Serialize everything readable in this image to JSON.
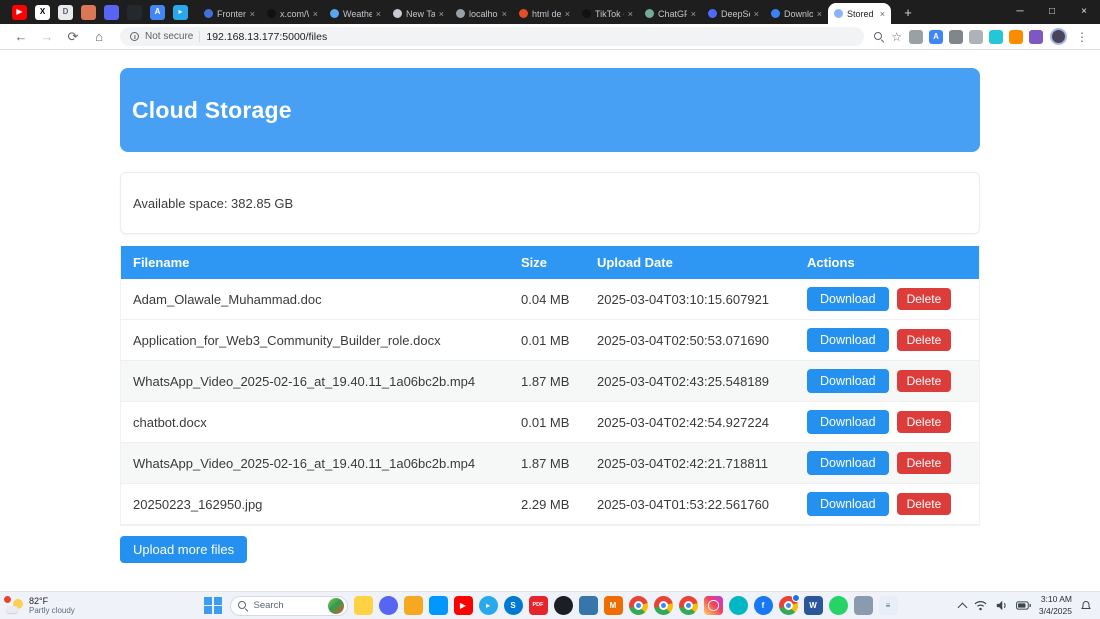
{
  "browser": {
    "new_tab_glyph": "+",
    "tab_close_glyph": "×",
    "window_controls": [
      "─",
      "□",
      "×"
    ],
    "nav_glyphs": {
      "back": "←",
      "forward": "→",
      "refresh": "⟳",
      "home": "⌂"
    },
    "bookmark_star_glyph": "☆",
    "menu_glyph": "⋮",
    "nav": {
      "security_label": "Not secure",
      "url": "192.168.13.177:5000/files"
    },
    "pinned_tabs": [
      {
        "name": "youtube-icon",
        "bg": "#ff0000",
        "fg": "#ffffff",
        "glyph": "▶"
      },
      {
        "name": "x-icon",
        "bg": "#ffffff",
        "fg": "#000000",
        "glyph": "X"
      },
      {
        "name": "docs-icon",
        "bg": "#e8eaed",
        "fg": "#5f6368",
        "glyph": "D"
      },
      {
        "name": "claude-icon",
        "bg": "#da7756",
        "fg": "#ffffff",
        "glyph": ""
      },
      {
        "name": "discord-icon",
        "bg": "#5865f2",
        "fg": "#ffffff",
        "glyph": ""
      },
      {
        "name": "github-icon",
        "bg": "#24292e",
        "fg": "#ffffff",
        "glyph": ""
      },
      {
        "name": "translate-icon",
        "bg": "#4285f4",
        "fg": "#ffffff",
        "glyph": "A"
      },
      {
        "name": "telegram-icon",
        "bg": "#29a9eb",
        "fg": "#ffffff",
        "glyph": "▸"
      }
    ],
    "tabs": [
      {
        "title": "Fronten",
        "favicon": "#4272d7"
      },
      {
        "title": "x.com/W",
        "favicon": "#111111"
      },
      {
        "title": "Weathe",
        "favicon": "#58a6f0"
      },
      {
        "title": "New Tab",
        "favicon": "#c7cbd1"
      },
      {
        "title": "localhost",
        "favicon": "#9aa0a6"
      },
      {
        "title": "html de",
        "favicon": "#e44d26"
      },
      {
        "title": "TikTok -",
        "favicon": "#111111"
      },
      {
        "title": "ChatGPT",
        "favicon": "#74aa9c"
      },
      {
        "title": "DeepSe",
        "favicon": "#4d6bfe"
      },
      {
        "title": "Downlo",
        "favicon": "#3b82f6"
      },
      {
        "title": "Stored F",
        "favicon": "#8ab4f8"
      }
    ],
    "extensions": [
      {
        "name": "keyboard-extension-icon",
        "bg": "#9aa0a6",
        "glyph": ""
      },
      {
        "name": "translate-extension-icon",
        "bg": "#4285f4",
        "fg": "#ffffff",
        "glyph": "A"
      },
      {
        "name": "cast-extension-icon",
        "bg": "#80868b",
        "glyph": ""
      },
      {
        "name": "image-extension-icon",
        "bg": "#aeb3b8",
        "glyph": ""
      },
      {
        "name": "teal-extension-icon",
        "bg": "#26c6da",
        "glyph": ""
      },
      {
        "name": "orange-extension-icon",
        "bg": "#fb8c00",
        "glyph": ""
      },
      {
        "name": "purple-extension-icon",
        "bg": "#7e57c2",
        "glyph": ""
      }
    ]
  },
  "page": {
    "header_title": "Cloud Storage",
    "available_space": "Available space: 382.85 GB",
    "upload_button": "Upload more files",
    "table": {
      "headers": [
        "Filename",
        "Size",
        "Upload Date",
        "Actions"
      ],
      "download_label": "Download",
      "delete_label": "Delete",
      "rows": [
        {
          "filename": "Adam_Olawale_Muhammad.doc",
          "size": "0.04 MB",
          "upload_date": "2025-03-04T03:10:15.607921"
        },
        {
          "filename": "Application_for_Web3_Community_Builder_role.docx",
          "size": "0.01 MB",
          "upload_date": "2025-03-04T02:50:53.071690"
        },
        {
          "filename": "WhatsApp_Video_2025-02-16_at_19.40.11_1a06bc2b.mp4",
          "size": "1.87 MB",
          "upload_date": "2025-03-04T02:43:25.548189"
        },
        {
          "filename": "chatbot.docx",
          "size": "0.01 MB",
          "upload_date": "2025-03-04T02:42:54.927224"
        },
        {
          "filename": "WhatsApp_Video_2025-02-16_at_19.40.11_1a06bc2b.mp4",
          "size": "1.87 MB",
          "upload_date": "2025-03-04T02:42:21.718811"
        },
        {
          "filename": "20250223_162950.jpg",
          "size": "2.29 MB",
          "upload_date": "2025-03-04T01:53:22.561760"
        }
      ]
    }
  },
  "taskbar": {
    "weather": {
      "temp": "82°F",
      "condition": "Partly cloudy"
    },
    "search_label": "Search",
    "tray": {
      "time": "3:10 AM",
      "date": "3/4/2025"
    },
    "icons": [
      {
        "name": "file-explorer-icon",
        "cls": "ic-sq",
        "bg": "#ffd243",
        "glyph": ""
      },
      {
        "name": "discord-icon",
        "cls": "ic-rd",
        "bg": "#5865f2",
        "glyph": ""
      },
      {
        "name": "folder-icon",
        "cls": "ic-sq",
        "bg": "#f6a821",
        "glyph": ""
      },
      {
        "name": "vscode-icon",
        "cls": "ic-sq",
        "bg": "#0098ff",
        "glyph": ""
      },
      {
        "name": "youtube-icon",
        "cls": "ic-sq",
        "bg": "#ff0000",
        "glyph": "▶"
      },
      {
        "name": "telegram-icon",
        "cls": "ic-rd",
        "bg": "#29a9eb",
        "glyph": "▸"
      },
      {
        "name": "skype-icon",
        "cls": "ic-rd",
        "bg": "#0078d4",
        "glyph": "S"
      },
      {
        "name": "pdf-icon",
        "cls": "ic-sq ic-pdf",
        "bg": "#e5252a",
        "glyph": "PDF"
      },
      {
        "name": "github-icon",
        "cls": "ic-rd",
        "bg": "#1b1f23",
        "glyph": ""
      },
      {
        "name": "python-icon",
        "cls": "ic-sq",
        "bg": "#3776ab",
        "glyph": ""
      },
      {
        "name": "gmail-icon",
        "cls": "ic-sq",
        "bg": "#ef6c00",
        "glyph": "M"
      },
      {
        "name": "chrome-icon",
        "cls": "ic-chrome",
        "glyph": ""
      },
      {
        "name": "chrome-icon-2",
        "cls": "ic-chrome",
        "glyph": ""
      },
      {
        "name": "chrome-icon-3",
        "cls": "ic-chrome",
        "glyph": ""
      },
      {
        "name": "instagram-icon",
        "cls": "ic-insta",
        "glyph": ""
      },
      {
        "name": "photos-icon",
        "cls": "ic-rd",
        "bg": "#00b7c3",
        "glyph": ""
      },
      {
        "name": "facebook-icon",
        "cls": "ic-rd",
        "bg": "#1877f2",
        "glyph": "f"
      },
      {
        "name": "chrome-active-icon",
        "cls": "ic-chrome active",
        "glyph": ""
      },
      {
        "name": "word-icon",
        "cls": "ic-sq",
        "bg": "#2b579a",
        "glyph": "W"
      },
      {
        "name": "whatsapp-icon",
        "cls": "ic-rd",
        "bg": "#25d366",
        "glyph": ""
      },
      {
        "name": "remote-desktop-icon",
        "cls": "ic-sq",
        "bg": "#8a9bb0",
        "glyph": ""
      },
      {
        "name": "notepad-icon",
        "cls": "ic-sq",
        "bg": "#e8eef7",
        "fg": "#5b6673",
        "glyph": "≡"
      }
    ]
  },
  "colors": {
    "header_blue": "#47a0f4",
    "table_header_blue": "#2e97f3",
    "primary_button_blue": "#2490ef",
    "danger_red": "#dd3d3a"
  }
}
